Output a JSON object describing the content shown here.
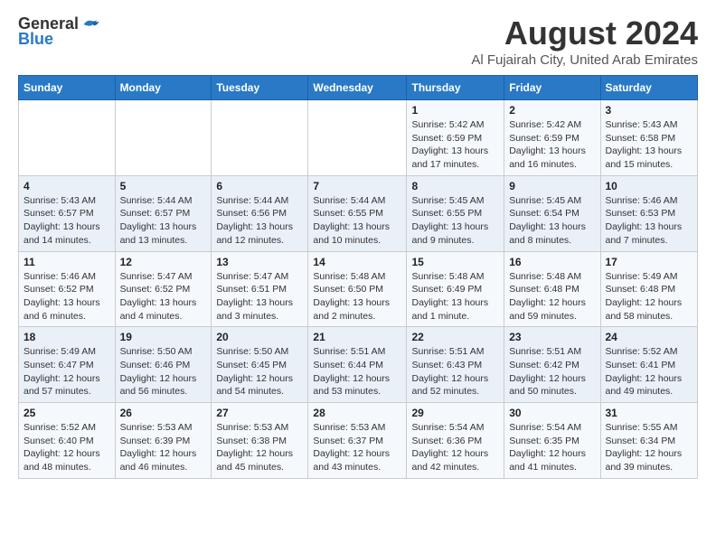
{
  "logo": {
    "general": "General",
    "blue": "Blue"
  },
  "header": {
    "title": "August 2024",
    "subtitle": "Al Fujairah City, United Arab Emirates"
  },
  "weekdays": [
    "Sunday",
    "Monday",
    "Tuesday",
    "Wednesday",
    "Thursday",
    "Friday",
    "Saturday"
  ],
  "weeks": [
    [
      {
        "day": "",
        "detail": ""
      },
      {
        "day": "",
        "detail": ""
      },
      {
        "day": "",
        "detail": ""
      },
      {
        "day": "",
        "detail": ""
      },
      {
        "day": "1",
        "detail": "Sunrise: 5:42 AM\nSunset: 6:59 PM\nDaylight: 13 hours\nand 17 minutes."
      },
      {
        "day": "2",
        "detail": "Sunrise: 5:42 AM\nSunset: 6:59 PM\nDaylight: 13 hours\nand 16 minutes."
      },
      {
        "day": "3",
        "detail": "Sunrise: 5:43 AM\nSunset: 6:58 PM\nDaylight: 13 hours\nand 15 minutes."
      }
    ],
    [
      {
        "day": "4",
        "detail": "Sunrise: 5:43 AM\nSunset: 6:57 PM\nDaylight: 13 hours\nand 14 minutes."
      },
      {
        "day": "5",
        "detail": "Sunrise: 5:44 AM\nSunset: 6:57 PM\nDaylight: 13 hours\nand 13 minutes."
      },
      {
        "day": "6",
        "detail": "Sunrise: 5:44 AM\nSunset: 6:56 PM\nDaylight: 13 hours\nand 12 minutes."
      },
      {
        "day": "7",
        "detail": "Sunrise: 5:44 AM\nSunset: 6:55 PM\nDaylight: 13 hours\nand 10 minutes."
      },
      {
        "day": "8",
        "detail": "Sunrise: 5:45 AM\nSunset: 6:55 PM\nDaylight: 13 hours\nand 9 minutes."
      },
      {
        "day": "9",
        "detail": "Sunrise: 5:45 AM\nSunset: 6:54 PM\nDaylight: 13 hours\nand 8 minutes."
      },
      {
        "day": "10",
        "detail": "Sunrise: 5:46 AM\nSunset: 6:53 PM\nDaylight: 13 hours\nand 7 minutes."
      }
    ],
    [
      {
        "day": "11",
        "detail": "Sunrise: 5:46 AM\nSunset: 6:52 PM\nDaylight: 13 hours\nand 6 minutes."
      },
      {
        "day": "12",
        "detail": "Sunrise: 5:47 AM\nSunset: 6:52 PM\nDaylight: 13 hours\nand 4 minutes."
      },
      {
        "day": "13",
        "detail": "Sunrise: 5:47 AM\nSunset: 6:51 PM\nDaylight: 13 hours\nand 3 minutes."
      },
      {
        "day": "14",
        "detail": "Sunrise: 5:48 AM\nSunset: 6:50 PM\nDaylight: 13 hours\nand 2 minutes."
      },
      {
        "day": "15",
        "detail": "Sunrise: 5:48 AM\nSunset: 6:49 PM\nDaylight: 13 hours\nand 1 minute."
      },
      {
        "day": "16",
        "detail": "Sunrise: 5:48 AM\nSunset: 6:48 PM\nDaylight: 12 hours\nand 59 minutes."
      },
      {
        "day": "17",
        "detail": "Sunrise: 5:49 AM\nSunset: 6:48 PM\nDaylight: 12 hours\nand 58 minutes."
      }
    ],
    [
      {
        "day": "18",
        "detail": "Sunrise: 5:49 AM\nSunset: 6:47 PM\nDaylight: 12 hours\nand 57 minutes."
      },
      {
        "day": "19",
        "detail": "Sunrise: 5:50 AM\nSunset: 6:46 PM\nDaylight: 12 hours\nand 56 minutes."
      },
      {
        "day": "20",
        "detail": "Sunrise: 5:50 AM\nSunset: 6:45 PM\nDaylight: 12 hours\nand 54 minutes."
      },
      {
        "day": "21",
        "detail": "Sunrise: 5:51 AM\nSunset: 6:44 PM\nDaylight: 12 hours\nand 53 minutes."
      },
      {
        "day": "22",
        "detail": "Sunrise: 5:51 AM\nSunset: 6:43 PM\nDaylight: 12 hours\nand 52 minutes."
      },
      {
        "day": "23",
        "detail": "Sunrise: 5:51 AM\nSunset: 6:42 PM\nDaylight: 12 hours\nand 50 minutes."
      },
      {
        "day": "24",
        "detail": "Sunrise: 5:52 AM\nSunset: 6:41 PM\nDaylight: 12 hours\nand 49 minutes."
      }
    ],
    [
      {
        "day": "25",
        "detail": "Sunrise: 5:52 AM\nSunset: 6:40 PM\nDaylight: 12 hours\nand 48 minutes."
      },
      {
        "day": "26",
        "detail": "Sunrise: 5:53 AM\nSunset: 6:39 PM\nDaylight: 12 hours\nand 46 minutes."
      },
      {
        "day": "27",
        "detail": "Sunrise: 5:53 AM\nSunset: 6:38 PM\nDaylight: 12 hours\nand 45 minutes."
      },
      {
        "day": "28",
        "detail": "Sunrise: 5:53 AM\nSunset: 6:37 PM\nDaylight: 12 hours\nand 43 minutes."
      },
      {
        "day": "29",
        "detail": "Sunrise: 5:54 AM\nSunset: 6:36 PM\nDaylight: 12 hours\nand 42 minutes."
      },
      {
        "day": "30",
        "detail": "Sunrise: 5:54 AM\nSunset: 6:35 PM\nDaylight: 12 hours\nand 41 minutes."
      },
      {
        "day": "31",
        "detail": "Sunrise: 5:55 AM\nSunset: 6:34 PM\nDaylight: 12 hours\nand 39 minutes."
      }
    ]
  ]
}
